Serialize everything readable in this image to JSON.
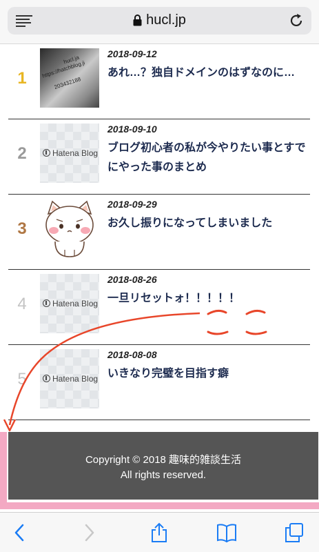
{
  "browser": {
    "url": "hucl.jp"
  },
  "ranking": [
    {
      "rank": "1",
      "date": "2018-09-12",
      "title": "あれ…？独自ドメインのはずなのに…",
      "rank_color": "#e8b623",
      "thumb": "photo"
    },
    {
      "rank": "2",
      "date": "2018-09-10",
      "title": "ブログ初心者の私が今やりたい事とすでにやった事のまとめ",
      "rank_color": "#9a9a9a",
      "thumb": "hatena"
    },
    {
      "rank": "3",
      "date": "2018-09-29",
      "title": "お久し振りになってしまいました",
      "rank_color": "#b07845",
      "thumb": "cat"
    },
    {
      "rank": "4",
      "date": "2018-08-26",
      "title": "一旦リセットォ！！！！！",
      "rank_color": "#c4c4c4",
      "thumb": "hatena"
    },
    {
      "rank": "5",
      "date": "2018-08-08",
      "title": "いきなり完璧を目指す癖",
      "rank_color": "#c4c4c4",
      "thumb": "hatena"
    }
  ],
  "thumbs": {
    "hatena_label": "Hatena Blog",
    "photo_lines": [
      "https://hatchblog.ji",
      "203432188",
      "hucl.ja"
    ]
  },
  "annotation": {
    "text": "ここ",
    "color": "#e8462a"
  },
  "footer": {
    "copyright": "Copyright © 2018 趣味的雑談生活",
    "rights": "All rights reserved.",
    "highlight_color": "#f3a9c3"
  }
}
